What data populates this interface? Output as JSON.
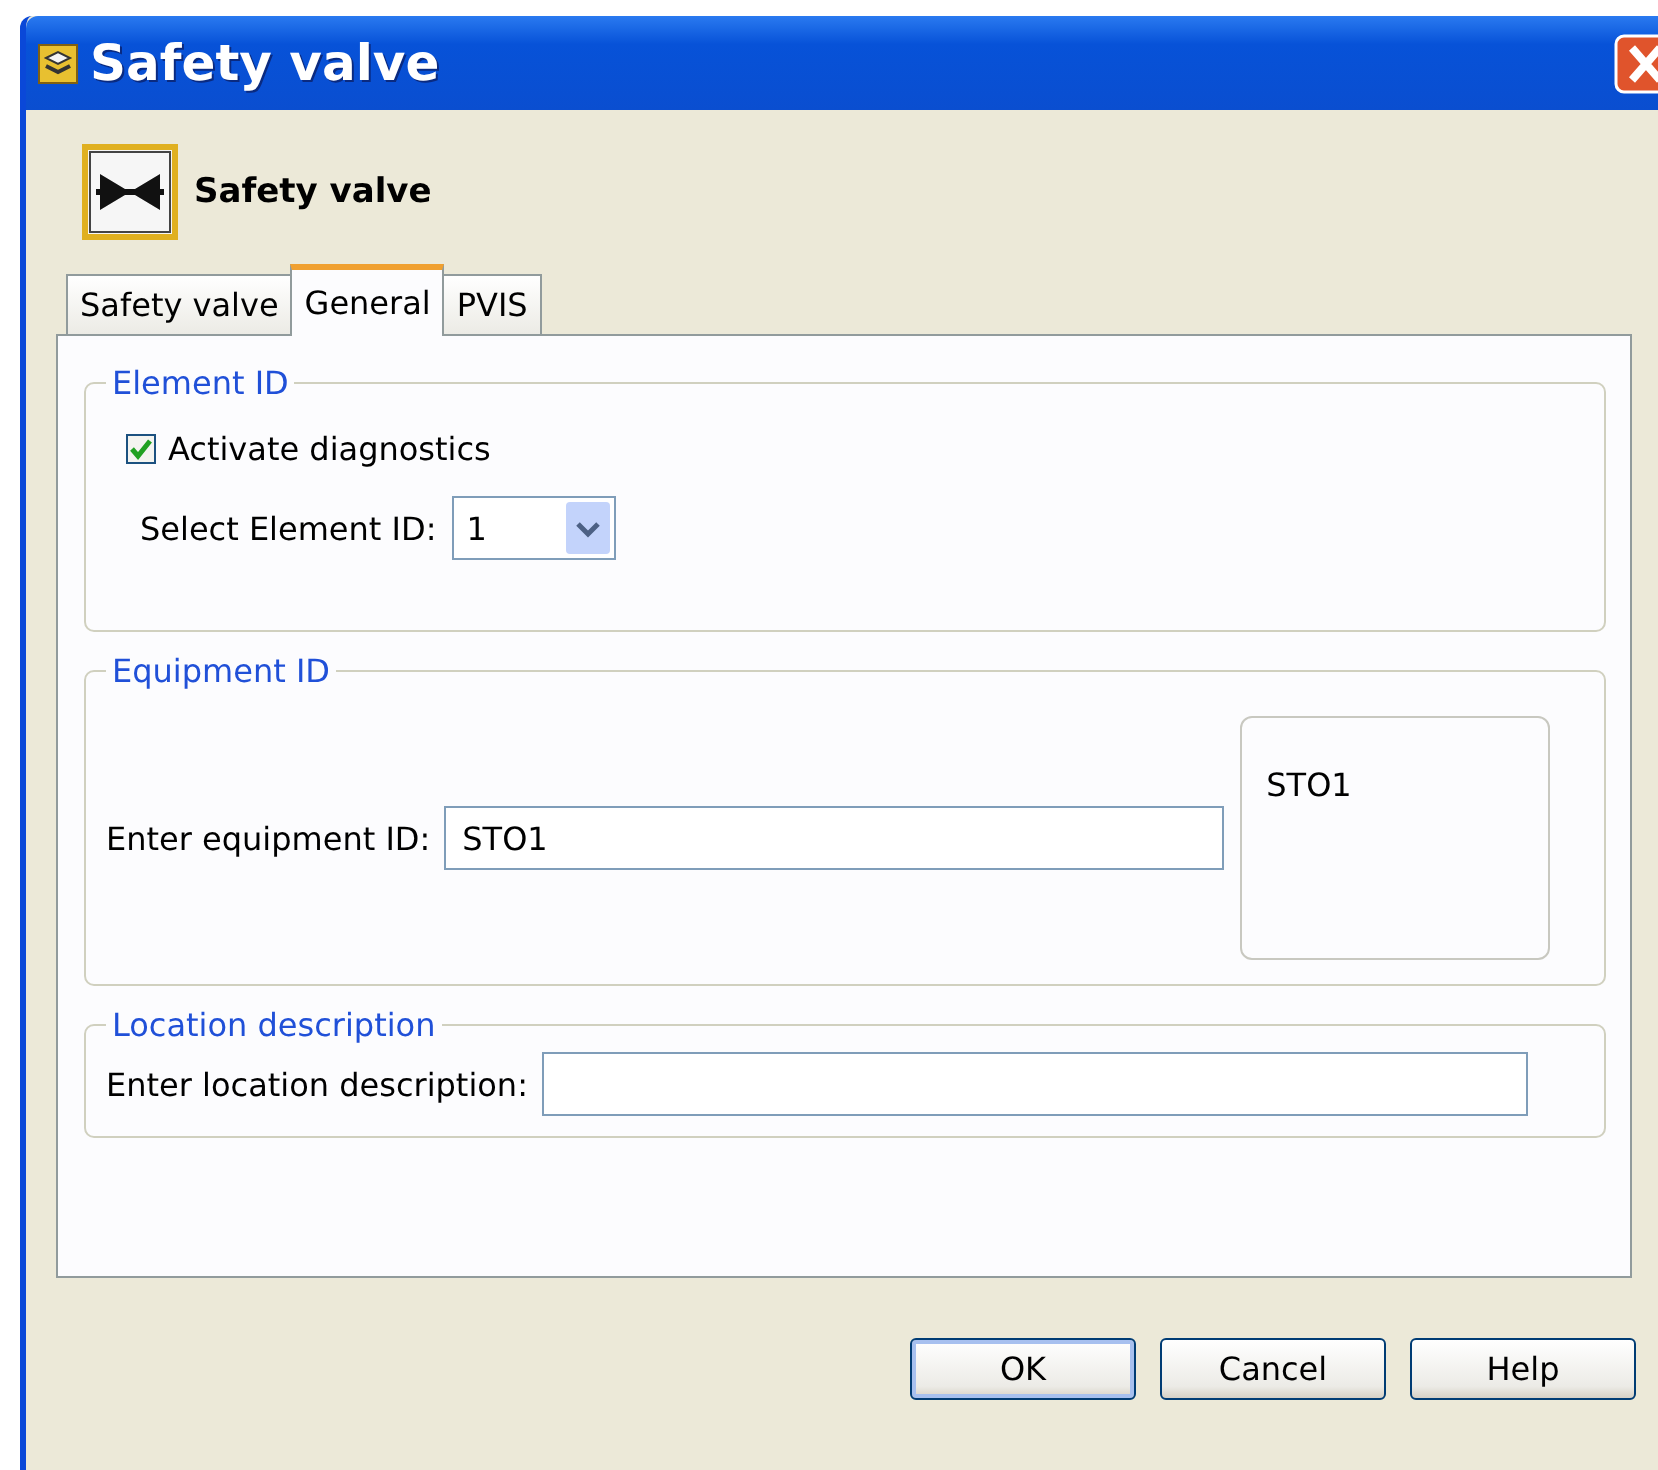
{
  "window": {
    "title": "Safety valve"
  },
  "header": {
    "title": "Safety valve"
  },
  "tabs": [
    {
      "label": "Safety valve",
      "selected": false
    },
    {
      "label": "General",
      "selected": true
    },
    {
      "label": "PVIS",
      "selected": false
    }
  ],
  "element_id": {
    "legend": "Element ID",
    "activate_diagnostics": {
      "label": "Activate diagnostics",
      "checked": true
    },
    "select_label": "Select Element ID:",
    "select_value": "1"
  },
  "equipment_id": {
    "legend": "Equipment ID",
    "label": "Enter equipment ID:",
    "value": "STO1",
    "preview": "STO1"
  },
  "location": {
    "legend": "Location description",
    "label": "Enter location description:"
  },
  "buttons": [
    {
      "label": "OK",
      "default": true
    },
    {
      "label": "Cancel",
      "default": false
    },
    {
      "label": "Help",
      "default": false
    }
  ]
}
